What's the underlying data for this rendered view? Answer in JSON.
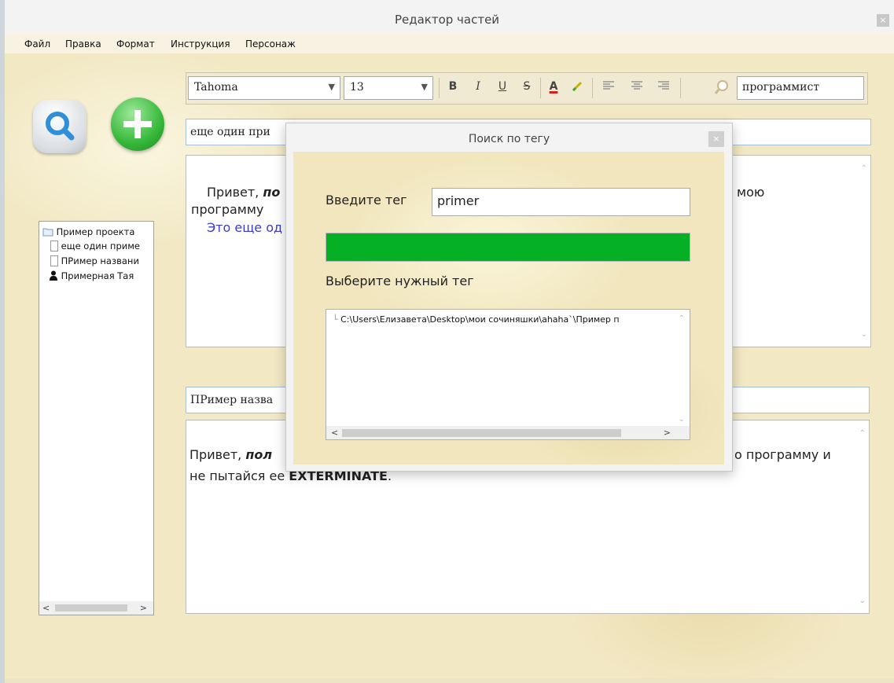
{
  "window": {
    "title": "Редактор частей",
    "close_glyph": "×"
  },
  "menu": [
    "Файл",
    "Правка",
    "Формат",
    "Инструкция",
    "Персонаж"
  ],
  "toolbar": {
    "font_family": "Tahoma",
    "font_size": "13",
    "bold": "B",
    "italic": "I",
    "underline": "U",
    "strike": "S",
    "font_color_glyph": "A",
    "search_value": "программист",
    "colors": {
      "accent_red": "#d22020",
      "green": "#06b025"
    }
  },
  "tree": {
    "items": [
      {
        "label": "Пример проекта",
        "icon": "folder-icon"
      },
      {
        "label": "еще один приме",
        "icon": "document-icon"
      },
      {
        "label": "ПРимер названи",
        "icon": "document-icon"
      },
      {
        "label": "Примерная Тая",
        "icon": "person-icon"
      }
    ],
    "scroll_left": "<",
    "scroll_right": ">"
  },
  "part1": {
    "title": "еще один при",
    "text_line1_start": "Привет, ",
    "text_line1_bold": "по",
    "text_line1_end": "мою",
    "text_line2": "программу",
    "text_line3": "Это еще од"
  },
  "part2": {
    "title": "ПРимер назва",
    "text_start": "Привет, ",
    "text_bold": "пол",
    "text_end": "о программу и",
    "line2_start": "не пытайся ее ",
    "line2_bold": "EXTERMINATE",
    "line2_end": "."
  },
  "dialog": {
    "title": "Поиск по тегу",
    "close_glyph": "×",
    "tag_label": "Введите тег",
    "tag_value": "primer",
    "progress": 1.0,
    "choose_label": "Выберите нужный тег",
    "list_items": [
      "C:\\Users\\Елизавета\\Desktop\\мои сочиняшки\\ahaha`\\Пример п"
    ],
    "scroll_left": "<",
    "scroll_right": ">"
  }
}
